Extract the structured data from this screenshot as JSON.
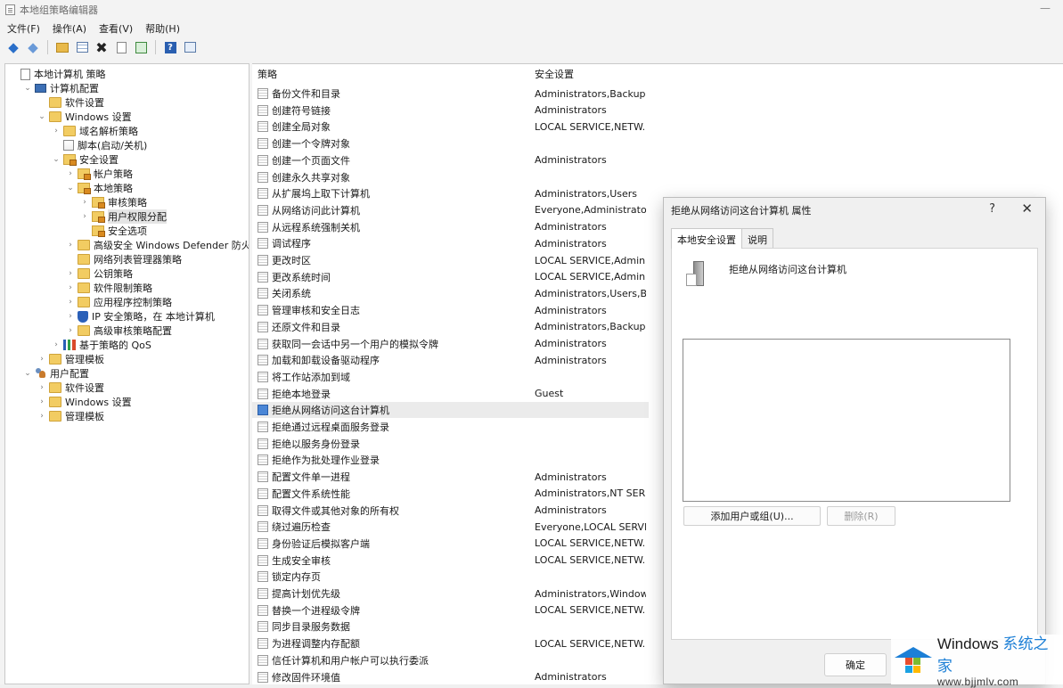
{
  "window": {
    "title": "本地组策略编辑器",
    "minimize_glyph": "—"
  },
  "menubar": [
    "文件(F)",
    "操作(A)",
    "查看(V)",
    "帮助(H)"
  ],
  "toolbar": {
    "icons": [
      "back-icon",
      "forward-icon",
      "up-folder-icon",
      "show-hide-tree-icon",
      "delete-icon",
      "properties-icon",
      "export-list-icon",
      "help-icon",
      "view-icon"
    ]
  },
  "tree": [
    {
      "label": "本地计算机 策略",
      "icon": "doc",
      "depth": 0,
      "twisty": ""
    },
    {
      "label": "计算机配置",
      "icon": "computer",
      "depth": 1,
      "twisty": "⌄"
    },
    {
      "label": "软件设置",
      "icon": "folder",
      "depth": 2,
      "twisty": ""
    },
    {
      "label": "Windows 设置",
      "icon": "folder",
      "depth": 2,
      "twisty": "⌄"
    },
    {
      "label": "域名解析策略",
      "icon": "folder",
      "depth": 3,
      "twisty": "›"
    },
    {
      "label": "脚本(启动/关机)",
      "icon": "script",
      "depth": 3,
      "twisty": ""
    },
    {
      "label": "安全设置",
      "icon": "folder-lock",
      "depth": 3,
      "twisty": "⌄"
    },
    {
      "label": "帐户策略",
      "icon": "folder-lock",
      "depth": 4,
      "twisty": "›"
    },
    {
      "label": "本地策略",
      "icon": "folder-lock",
      "depth": 4,
      "twisty": "⌄"
    },
    {
      "label": "审核策略",
      "icon": "folder-lock",
      "depth": 5,
      "twisty": "›"
    },
    {
      "label": "用户权限分配",
      "icon": "folder-lock",
      "depth": 5,
      "twisty": "›",
      "selected": true
    },
    {
      "label": "安全选项",
      "icon": "folder-lock",
      "depth": 5,
      "twisty": ""
    },
    {
      "label": "高级安全 Windows Defender 防火墙",
      "icon": "folder",
      "depth": 4,
      "twisty": "›"
    },
    {
      "label": "网络列表管理器策略",
      "icon": "folder",
      "depth": 4,
      "twisty": ""
    },
    {
      "label": "公钥策略",
      "icon": "folder",
      "depth": 4,
      "twisty": "›"
    },
    {
      "label": "软件限制策略",
      "icon": "folder",
      "depth": 4,
      "twisty": "›"
    },
    {
      "label": "应用程序控制策略",
      "icon": "folder",
      "depth": 4,
      "twisty": "›"
    },
    {
      "label": "IP 安全策略，在 本地计算机",
      "icon": "shield",
      "depth": 4,
      "twisty": "›"
    },
    {
      "label": "高级审核策略配置",
      "icon": "folder",
      "depth": 4,
      "twisty": "›"
    },
    {
      "label": "基于策略的 QoS",
      "icon": "chart",
      "depth": 3,
      "twisty": "›"
    },
    {
      "label": "管理模板",
      "icon": "folder",
      "depth": 2,
      "twisty": "›"
    },
    {
      "label": "用户配置",
      "icon": "users",
      "depth": 1,
      "twisty": "⌄"
    },
    {
      "label": "软件设置",
      "icon": "folder",
      "depth": 2,
      "twisty": "›"
    },
    {
      "label": "Windows 设置",
      "icon": "folder",
      "depth": 2,
      "twisty": "›"
    },
    {
      "label": "管理模板",
      "icon": "folder",
      "depth": 2,
      "twisty": "›"
    }
  ],
  "list": {
    "col_policy": "策略",
    "col_setting": "安全设置",
    "rows": [
      {
        "policy": "备份文件和目录",
        "setting": "Administrators,Backup ..."
      },
      {
        "policy": "创建符号链接",
        "setting": "Administrators"
      },
      {
        "policy": "创建全局对象",
        "setting": "LOCAL SERVICE,NETW..."
      },
      {
        "policy": "创建一个令牌对象",
        "setting": ""
      },
      {
        "policy": "创建一个页面文件",
        "setting": "Administrators"
      },
      {
        "policy": "创建永久共享对象",
        "setting": ""
      },
      {
        "policy": "从扩展坞上取下计算机",
        "setting": "Administrators,Users"
      },
      {
        "policy": "从网络访问此计算机",
        "setting": "Everyone,Administrator..."
      },
      {
        "policy": "从远程系统强制关机",
        "setting": "Administrators"
      },
      {
        "policy": "调试程序",
        "setting": "Administrators"
      },
      {
        "policy": "更改时区",
        "setting": "LOCAL SERVICE,Admini..."
      },
      {
        "policy": "更改系统时间",
        "setting": "LOCAL SERVICE,Admini..."
      },
      {
        "policy": "关闭系统",
        "setting": "Administrators,Users,Ba..."
      },
      {
        "policy": "管理审核和安全日志",
        "setting": "Administrators"
      },
      {
        "policy": "还原文件和目录",
        "setting": "Administrators,Backup ..."
      },
      {
        "policy": "获取同一会话中另一个用户的模拟令牌",
        "setting": "Administrators"
      },
      {
        "policy": "加载和卸载设备驱动程序",
        "setting": "Administrators"
      },
      {
        "policy": "将工作站添加到域",
        "setting": ""
      },
      {
        "policy": "拒绝本地登录",
        "setting": "Guest"
      },
      {
        "policy": "拒绝从网络访问这台计算机",
        "setting": "",
        "selected": true
      },
      {
        "policy": "拒绝通过远程桌面服务登录",
        "setting": ""
      },
      {
        "policy": "拒绝以服务身份登录",
        "setting": ""
      },
      {
        "policy": "拒绝作为批处理作业登录",
        "setting": ""
      },
      {
        "policy": "配置文件单一进程",
        "setting": "Administrators"
      },
      {
        "policy": "配置文件系统性能",
        "setting": "Administrators,NT SER..."
      },
      {
        "policy": "取得文件或其他对象的所有权",
        "setting": "Administrators"
      },
      {
        "policy": "绕过遍历检查",
        "setting": "Everyone,LOCAL SERVI..."
      },
      {
        "policy": "身份验证后模拟客户端",
        "setting": "LOCAL SERVICE,NETW..."
      },
      {
        "policy": "生成安全审核",
        "setting": "LOCAL SERVICE,NETW..."
      },
      {
        "policy": "锁定内存页",
        "setting": ""
      },
      {
        "policy": "提高计划优先级",
        "setting": "Administrators,Window ..."
      },
      {
        "policy": "替换一个进程级令牌",
        "setting": "LOCAL SERVICE,NETW..."
      },
      {
        "policy": "同步目录服务数据",
        "setting": ""
      },
      {
        "policy": "为进程调整内存配额",
        "setting": "LOCAL SERVICE,NETW..."
      },
      {
        "policy": "信任计算机和用户帐户可以执行委派",
        "setting": ""
      },
      {
        "policy": "修改固件环境值",
        "setting": "Administrators"
      }
    ]
  },
  "dialog": {
    "title": "拒绝从网络访问这台计算机 属性",
    "help_glyph": "?",
    "close_glyph": "✕",
    "tabs": [
      "本地安全设置",
      "说明"
    ],
    "policy_name": "拒绝从网络访问这台计算机",
    "add_button": "添加用户或组(U)...",
    "remove_button": "删除(R)",
    "ok_button": "确定"
  },
  "watermark": {
    "brand": "Windows",
    "brand_cn": "系统之家",
    "url": "www.bjjmlv.com"
  }
}
